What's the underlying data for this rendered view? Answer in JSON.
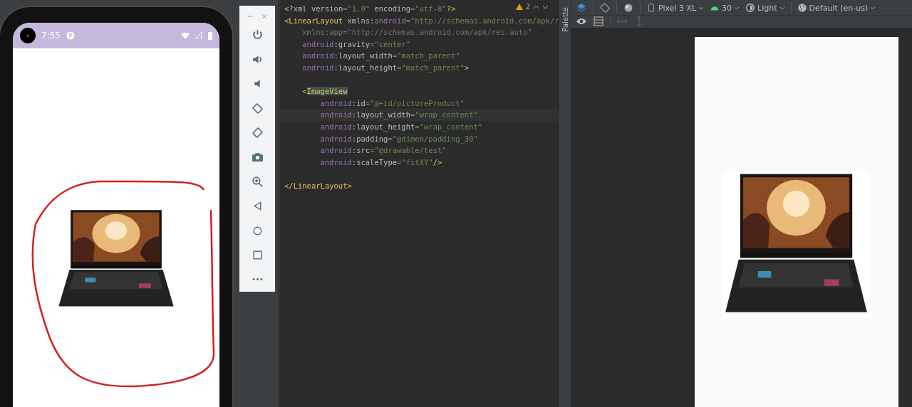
{
  "phone": {
    "status_bar": {
      "time": "7:55"
    }
  },
  "editor": {
    "warnings": "2",
    "blocks": [
      [
        {
          "selected": false,
          "tokens": [
            {
              "kind": "tag",
              "text": "<?"
            },
            {
              "kind": "plain",
              "text": "xml "
            },
            {
              "kind": "plain",
              "text": "version"
            },
            {
              "kind": "value",
              "text": "=\"1.0\""
            },
            {
              "kind": "plain",
              "text": " encoding"
            },
            {
              "kind": "value",
              "text": "=\"utf-8\""
            },
            {
              "kind": "tag",
              "text": "?>"
            }
          ]
        },
        {
          "selected": false,
          "tokens": [
            {
              "kind": "tag",
              "text": "<LinearLayout"
            },
            {
              "kind": "plain",
              "text": " xmlns:"
            },
            {
              "kind": "ns",
              "text": "android"
            },
            {
              "kind": "value",
              "text": "=\"http://schemas.android.com/apk/r"
            }
          ]
        },
        {
          "selected": false,
          "tokens": [
            {
              "kind": "dim",
              "text": "    xmlns:app=\"http://schemas.android.com/apk/res-auto\""
            }
          ]
        },
        {
          "selected": false,
          "tokens": [
            {
              "kind": "ns",
              "text": "    android"
            },
            {
              "kind": "plain",
              "text": ":gravity"
            },
            {
              "kind": "value",
              "text": "=\"center\""
            }
          ]
        },
        {
          "selected": false,
          "tokens": [
            {
              "kind": "ns",
              "text": "    android"
            },
            {
              "kind": "plain",
              "text": ":layout_width"
            },
            {
              "kind": "value",
              "text": "=\"match_parent\""
            }
          ]
        },
        {
          "selected": false,
          "tokens": [
            {
              "kind": "ns",
              "text": "    android"
            },
            {
              "kind": "plain",
              "text": ":layout_height"
            },
            {
              "kind": "value",
              "text": "=\"match_parent\""
            },
            {
              "kind": "tag",
              "text": ">"
            }
          ]
        }
      ],
      [
        {
          "selected": false,
          "tokens": [
            {
              "kind": "tag",
              "text": "    <"
            },
            {
              "kind": "match",
              "text": "ImageView"
            }
          ]
        },
        {
          "selected": false,
          "tokens": [
            {
              "kind": "ns",
              "text": "        android"
            },
            {
              "kind": "plain",
              "text": ":id"
            },
            {
              "kind": "value",
              "text": "=\"@+id/pictureProduct\""
            }
          ]
        },
        {
          "selected": true,
          "tokens": [
            {
              "kind": "ns",
              "text": "        android"
            },
            {
              "kind": "plain",
              "text": ":layout_width"
            },
            {
              "kind": "value",
              "text": "=\"wrap_content\""
            }
          ]
        },
        {
          "selected": false,
          "tokens": [
            {
              "kind": "ns",
              "text": "        android"
            },
            {
              "kind": "plain",
              "text": ":layout_height"
            },
            {
              "kind": "value",
              "text": "=\"wrap_content\""
            }
          ]
        },
        {
          "selected": false,
          "tokens": [
            {
              "kind": "ns",
              "text": "        android"
            },
            {
              "kind": "plain",
              "text": ":padding"
            },
            {
              "kind": "value",
              "text": "=\"@dimen/padding_30\""
            }
          ]
        },
        {
          "selected": false,
          "tokens": [
            {
              "kind": "ns",
              "text": "        android"
            },
            {
              "kind": "plain",
              "text": ":src"
            },
            {
              "kind": "value",
              "text": "=\"@drawable/test\""
            }
          ]
        },
        {
          "selected": false,
          "tokens": [
            {
              "kind": "ns",
              "text": "        android"
            },
            {
              "kind": "plain",
              "text": ":scaleType"
            },
            {
              "kind": "value",
              "text": "=\"fitXY\""
            },
            {
              "kind": "tag",
              "text": "/>"
            }
          ]
        }
      ],
      [
        {
          "selected": false,
          "tokens": [
            {
              "kind": "tag",
              "text": "</LinearLayout>"
            }
          ]
        }
      ]
    ]
  },
  "design": {
    "palette_label": "Palette",
    "device": "Pixel 3 XL",
    "api": "30",
    "theme": "Light",
    "locale": "Default (en-us)"
  }
}
